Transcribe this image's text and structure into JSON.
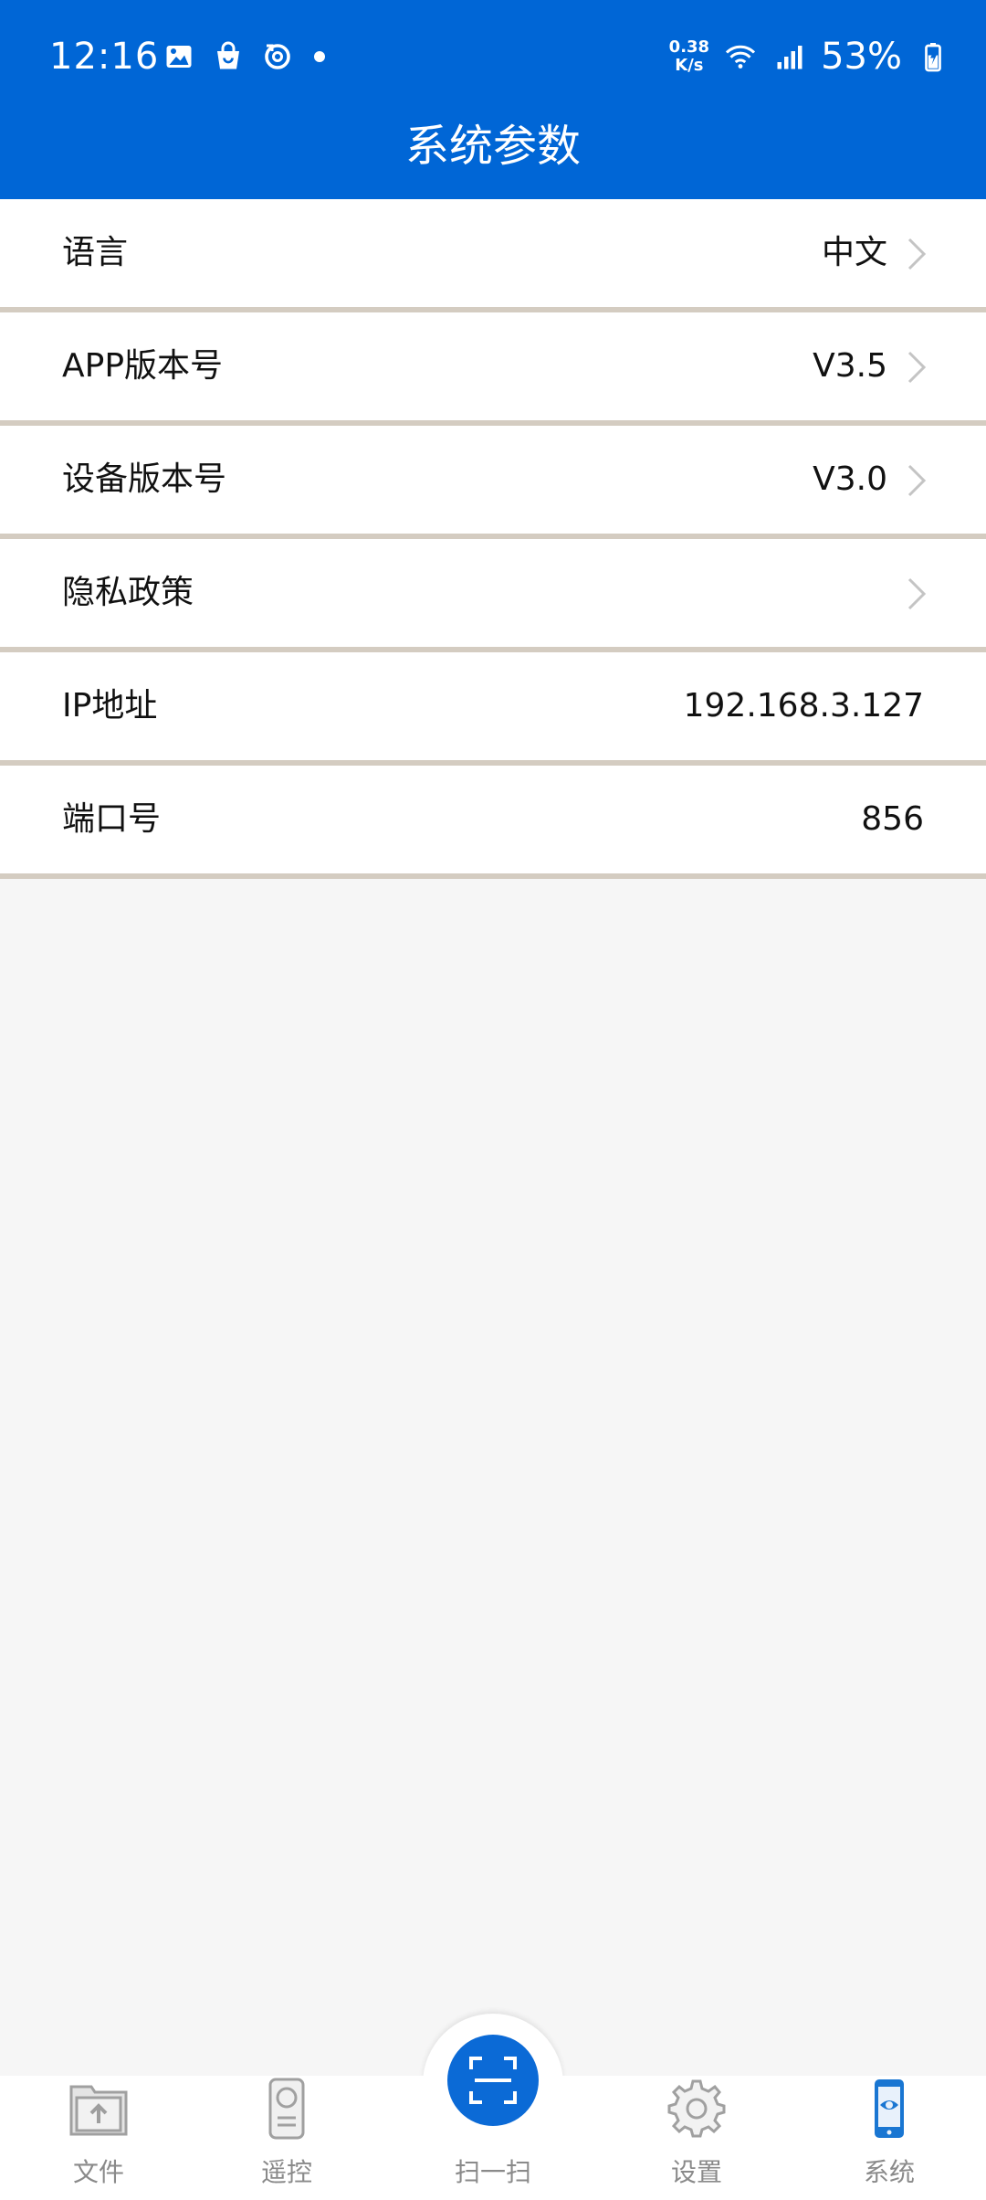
{
  "status_bar": {
    "time": "12:16",
    "net_speed_value": "0.38",
    "net_speed_unit": "K/s",
    "battery_percent": "53%",
    "left_icons": [
      "image-icon",
      "shopping-bag-icon",
      "sync-icon",
      "notification-dot"
    ],
    "right_icons": [
      "wifi-icon",
      "signal-icon",
      "battery-charging-icon"
    ]
  },
  "header": {
    "title": "系统参数"
  },
  "settings": [
    {
      "label": "语言",
      "value": "中文",
      "chevron": true
    },
    {
      "label": "APP版本号",
      "value": "V3.5",
      "chevron": true
    },
    {
      "label": "设备版本号",
      "value": "V3.0",
      "chevron": true
    },
    {
      "label": "隐私政策",
      "value": "",
      "chevron": true
    },
    {
      "label": "IP地址",
      "value": "192.168.3.127",
      "chevron": false
    },
    {
      "label": "端口号",
      "value": "856",
      "chevron": false
    }
  ],
  "bottom_nav": {
    "items": [
      {
        "label": "文件",
        "icon": "file-upload-icon"
      },
      {
        "label": "遥控",
        "icon": "remote-control-icon"
      },
      {
        "label": "扫一扫",
        "icon": "scan-icon"
      },
      {
        "label": "设置",
        "icon": "gear-icon"
      },
      {
        "label": "系统",
        "icon": "phone-system-icon",
        "active": true
      }
    ]
  },
  "colors": {
    "header_bg": "#0066d6",
    "divider": "#d4ccc1",
    "page_bg": "#f6f6f6",
    "active_icon": "#1976d2",
    "inactive_icon": "#9e9e9e"
  }
}
